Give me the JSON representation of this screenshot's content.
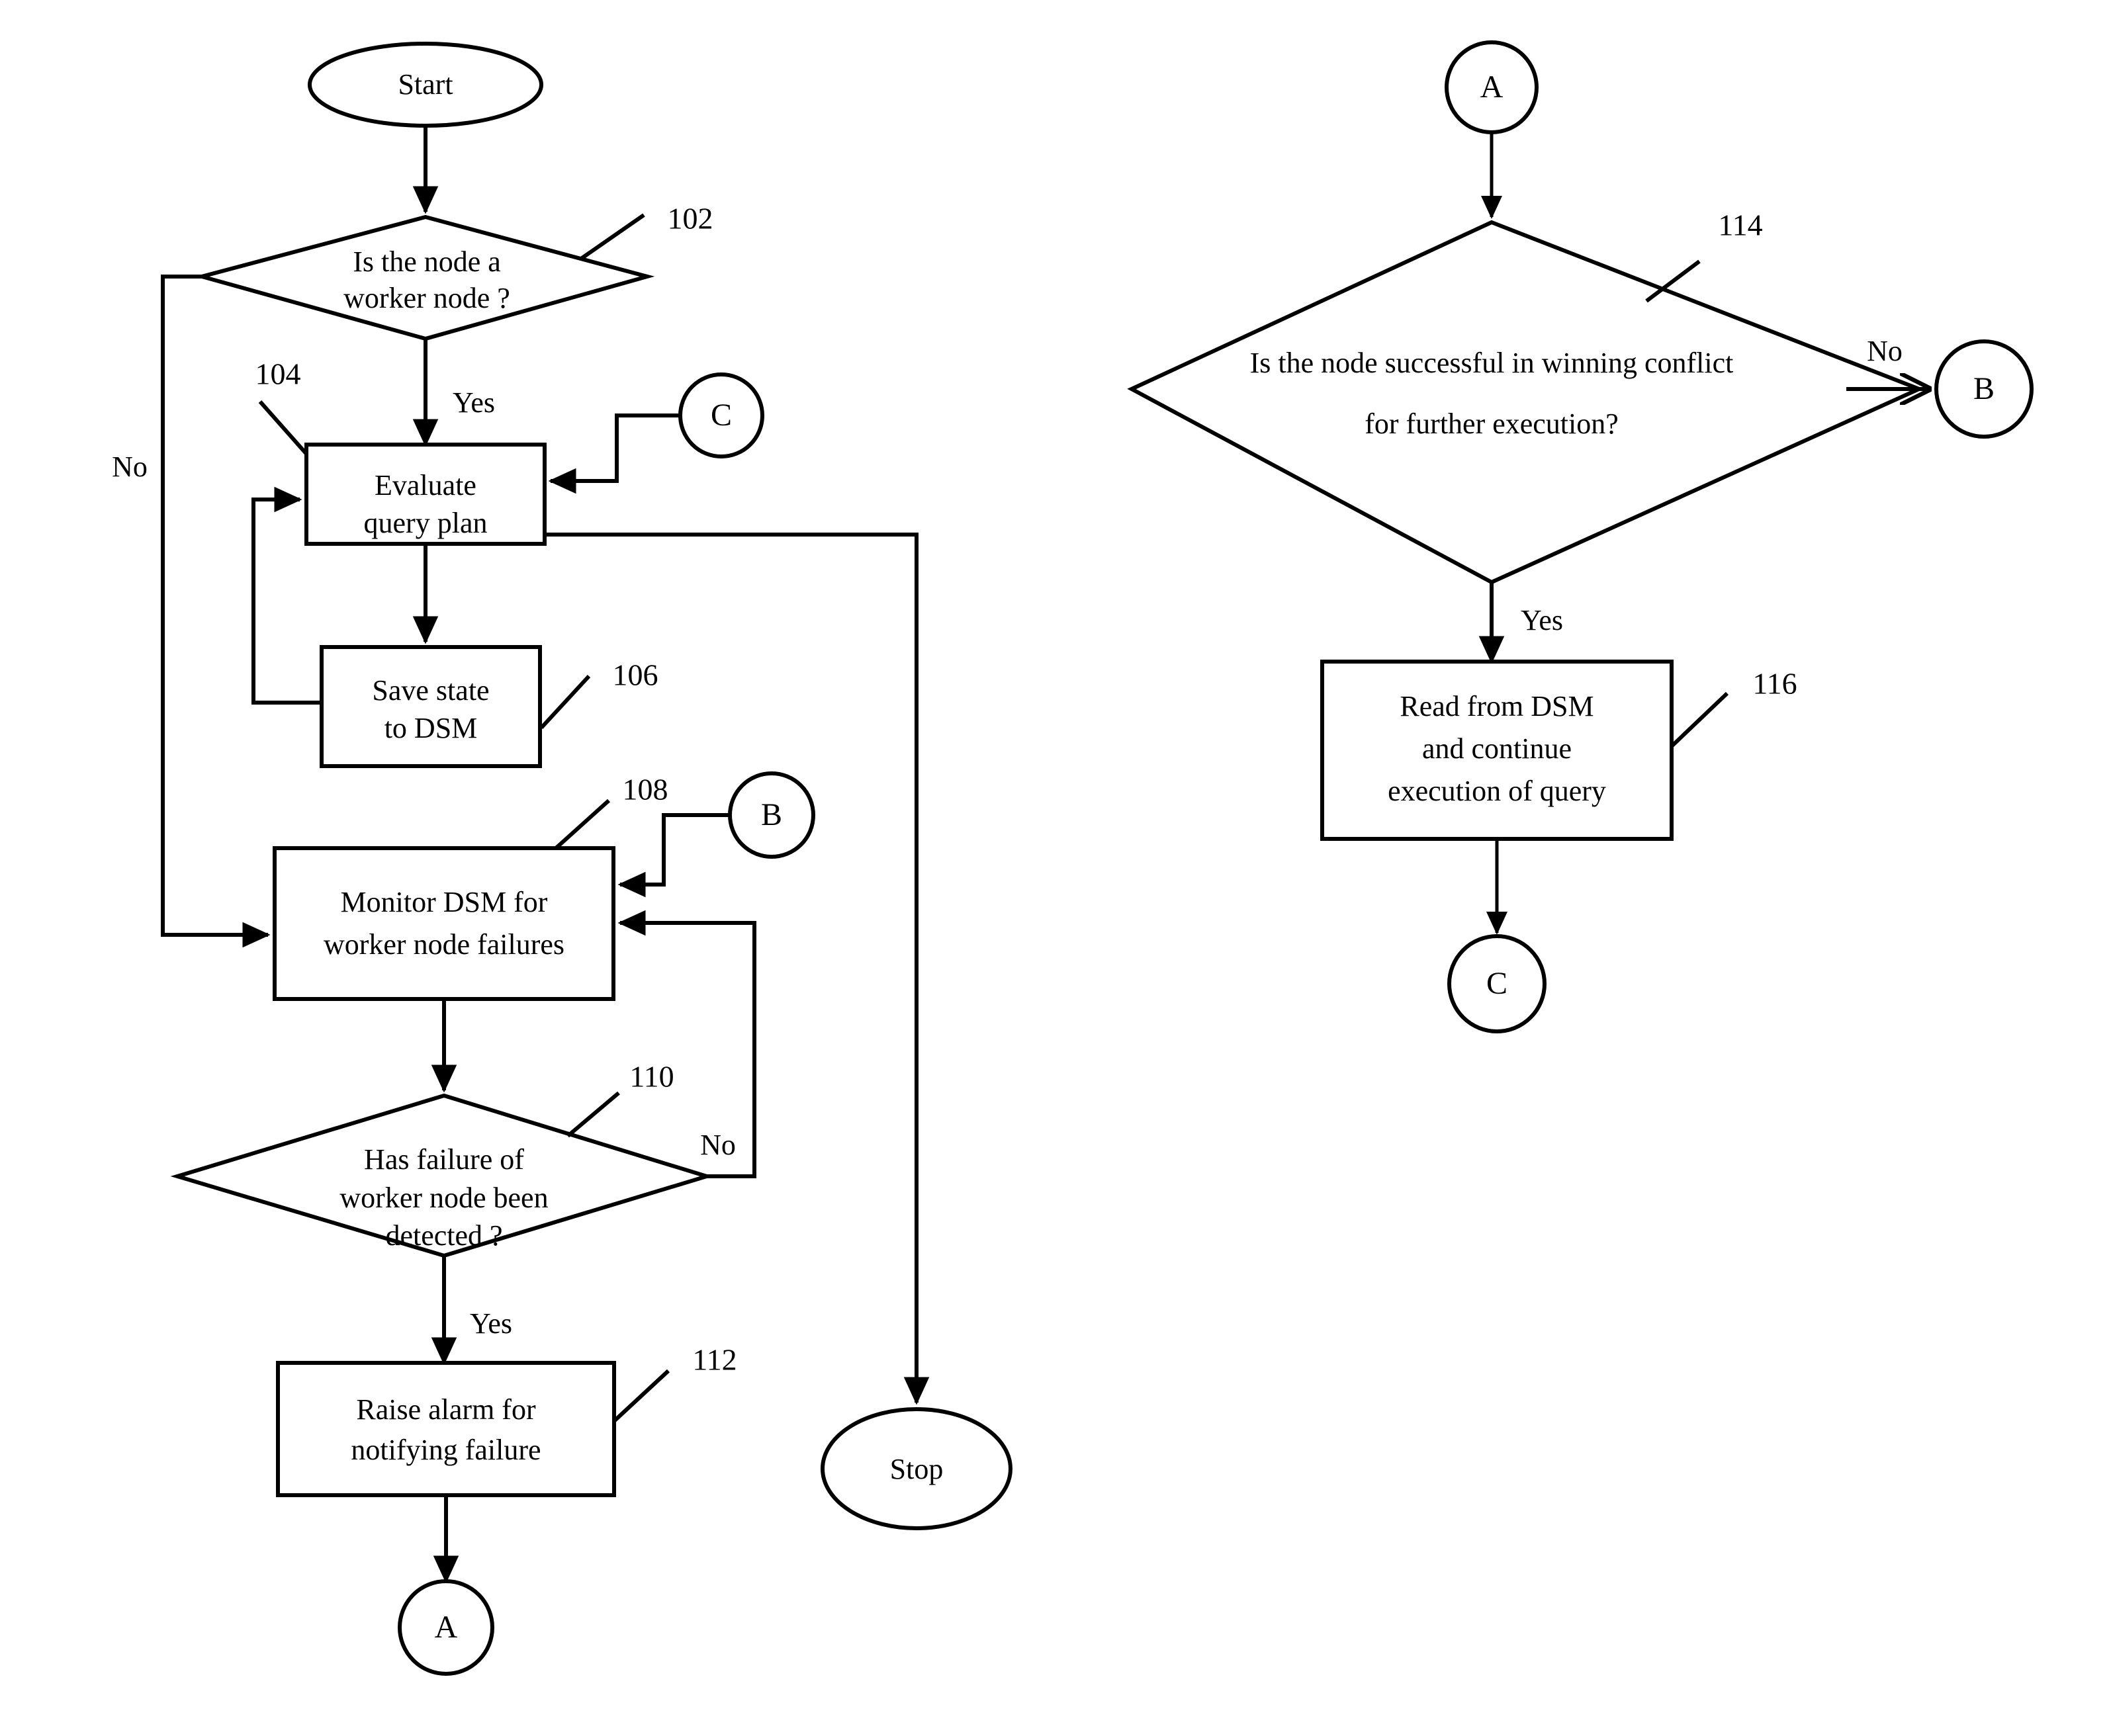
{
  "diagram": {
    "type": "flowchart",
    "title": "",
    "background": "#ffffff",
    "stroke_color": "#000000"
  },
  "left_flow": {
    "start": {
      "label": "Start"
    },
    "decision_102": {
      "line1": "Is the node a",
      "line2": "worker node ?",
      "ref": "102",
      "yes_label": "Yes",
      "no_label": "No"
    },
    "process_104": {
      "line1": "Evaluate",
      "line2": "query plan",
      "ref": "104"
    },
    "process_106": {
      "line1": "Save state",
      "line2": "to  DSM",
      "ref": "106"
    },
    "process_108": {
      "line1": "Monitor DSM for",
      "line2": "worker node failures",
      "ref": "108"
    },
    "decision_110": {
      "line1": "Has failure of",
      "line2": "worker node been",
      "line3": "detected ?",
      "ref": "110",
      "yes_label": "Yes",
      "no_label": "No"
    },
    "process_112": {
      "line1": "Raise alarm for",
      "line2": "notifying failure",
      "ref": "112"
    },
    "connector_c_in": {
      "label": "C"
    },
    "connector_b_in": {
      "label": "B"
    },
    "connector_a_out": {
      "label": "A"
    },
    "stop": {
      "label": "Stop"
    }
  },
  "right_flow": {
    "connector_a_in": {
      "label": "A"
    },
    "decision_114": {
      "line1": "Is the node successful in winning conflict",
      "line2": "for further execution?",
      "ref": "114",
      "yes_label": "Yes",
      "no_label": "No"
    },
    "process_116": {
      "line1": "Read from DSM",
      "line2": "and continue",
      "line3": "execution of query",
      "ref": "116"
    },
    "connector_b_out": {
      "label": "B"
    },
    "connector_c_out": {
      "label": "C"
    }
  }
}
